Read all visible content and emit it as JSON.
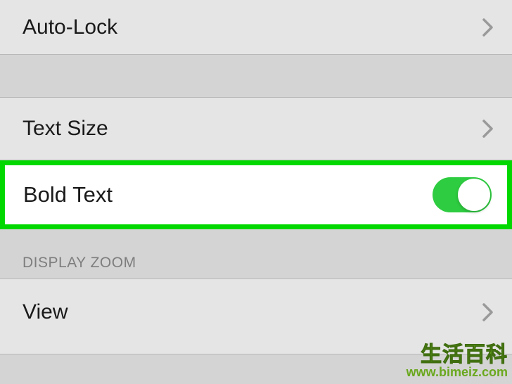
{
  "rows": {
    "autolock": {
      "label": "Auto-Lock"
    },
    "textsize": {
      "label": "Text Size"
    },
    "boldtext": {
      "label": "Bold Text",
      "toggle": true
    },
    "view": {
      "label": "View"
    }
  },
  "sections": {
    "displayzoom": {
      "header": "DISPLAY ZOOM"
    }
  },
  "watermark": {
    "line1": "生活百科",
    "line2": "www.bimeiz.com"
  },
  "colors": {
    "highlight": "#00d800",
    "toggle_on": "#2ecc40"
  }
}
